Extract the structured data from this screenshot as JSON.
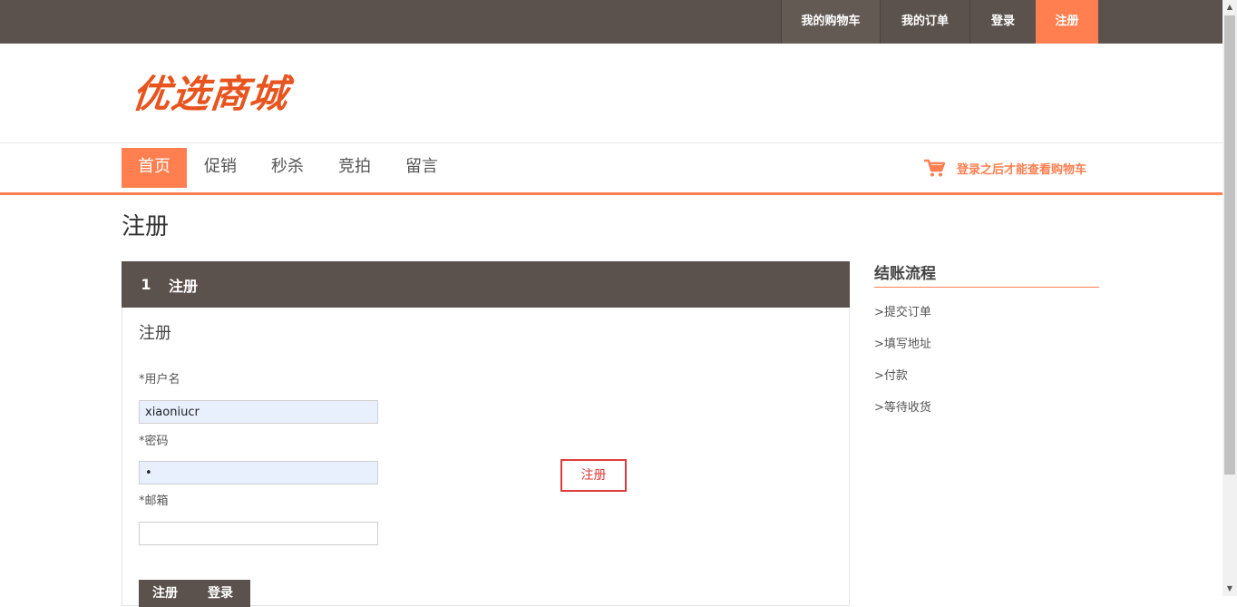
{
  "topnav": {
    "cart": "我的购物车",
    "orders": "我的订单",
    "login": "登录",
    "register": "注册"
  },
  "logo": {
    "text": "优选商城"
  },
  "mainnav": {
    "items": [
      "首页",
      "促销",
      "秒杀",
      "竞拍",
      "留言"
    ],
    "active": "首页"
  },
  "cart_hint": {
    "text": "登录之后才能查看购物车",
    "icon": "shopping-cart-icon"
  },
  "page": {
    "title": "注册"
  },
  "panel": {
    "step_number": "1",
    "step_title": "注册",
    "form_title": "注册",
    "username_label": "*用户名",
    "username_value": "xiaoniucr",
    "password_label": "*密码",
    "password_value": "•",
    "email_label": "*邮箱",
    "email_value": "",
    "floating_register": "注册",
    "register_button": "注册",
    "login_button": "登录"
  },
  "sidebar": {
    "title": "结账流程",
    "items": [
      ">提交订单",
      ">填写地址",
      ">付款",
      ">等待收货"
    ]
  },
  "colors": {
    "accent": "#ff7f50",
    "dark_bar": "#5c524d",
    "highlight_border": "#e03a3a"
  }
}
